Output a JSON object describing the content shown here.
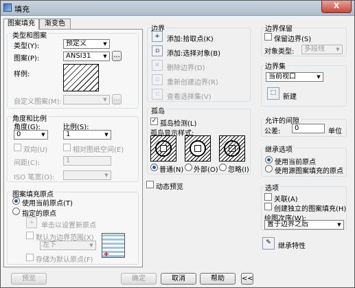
{
  "window": {
    "title": "填充",
    "close": "X"
  },
  "tabs": [
    "图案填充",
    "渐变色"
  ],
  "type_group": {
    "title": "类型和图案",
    "type_label": "类型(Y):",
    "type_value": "预定义",
    "pattern_label": "图案(P):",
    "pattern_value": "ANSI31",
    "browse": "...",
    "swatch_label": "样例:",
    "custom_label": "自定义图案(M):",
    "custom_browse": "..."
  },
  "angle_group": {
    "title": "角度和比例",
    "angle_label": "角度(G):",
    "angle_value": "0",
    "scale_label": "比例(S):",
    "scale_value": "1",
    "double": "双向(U)",
    "relative": "相对图纸空间(E)",
    "spacing_label": "间距(C):",
    "spacing_value": "1",
    "iso_label": "ISO 笔宽(O):"
  },
  "origin_group": {
    "title": "图案填充原点",
    "use_current": "使用当前原点(T)",
    "specified": "指定的原点",
    "click_set": "单击以设置新原点",
    "default_boundary": "默认为边界范围(X)",
    "corner_value": "左下",
    "store_default": "存储为默认原点(F)"
  },
  "boundary": {
    "title": "边界",
    "pick_points": "添加:拾取点(K)",
    "select_objects": "添加:选择对象(B)",
    "remove": "删除边界(D)",
    "recreate": "重新创建边界(R)",
    "view": "查看选择集(V)"
  },
  "islands": {
    "title": "孤岛",
    "detect": "孤岛检测(L)",
    "style_label": "孤岛显示样式:",
    "normal": "普通(N)",
    "outer": "外部(O)",
    "ignore": "忽略(I)"
  },
  "preview_dynamic": "动态预览",
  "retain": {
    "title": "边界保留",
    "retain_label": "保留边界(S)",
    "obj_type_label": "对象类型:",
    "obj_type_value": "多段线"
  },
  "boundary_set": {
    "title": "边界集",
    "value": "当前视口",
    "new": "新建"
  },
  "gap": {
    "title": "允许的间隙",
    "tolerance_label": "公差:",
    "tolerance_value": "0",
    "unit": "单位"
  },
  "inherit_options": {
    "title": "继承选项",
    "use_current": "使用当前原点",
    "use_source": "使用源图案填充的原点"
  },
  "options": {
    "title": "选项",
    "associative": "关联(A)",
    "independent": "创建独立的图案填充(H)",
    "draw_order_label": "绘图次序(W):",
    "draw_order_value": "置于边界之后"
  },
  "inherit_props": "继承特性",
  "footer": {
    "preview": "预览",
    "ok": "确定",
    "cancel": "取消",
    "help": "帮助",
    "collapse": "<<"
  }
}
